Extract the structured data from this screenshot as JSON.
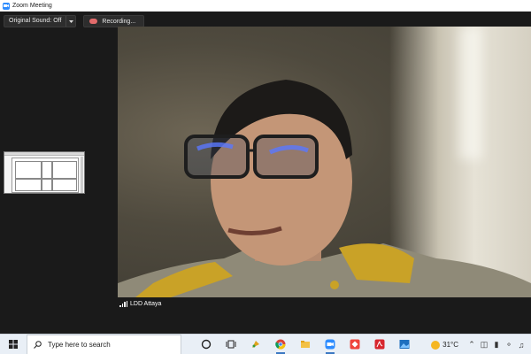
{
  "window": {
    "title": "Zoom Meeting"
  },
  "meeting_toolbar": {
    "original_sound_label": "Original Sound: Off",
    "recording_label": "Recording..."
  },
  "participant": {
    "name": "LDD Attaya"
  },
  "taskbar": {
    "search_placeholder": "Type here to search",
    "temperature": "31°C",
    "pinned_icons": [
      "cortana-icon",
      "task-view-icon",
      "paint-icon",
      "chrome-icon",
      "file-explorer-icon",
      "zoom-icon",
      "anydesk-icon",
      "acrobat-icon",
      "photos-icon"
    ],
    "tray_icons": [
      "chevron-up-icon",
      "network-icon",
      "battery-icon",
      "wifi-icon",
      "volume-icon"
    ]
  },
  "colors": {
    "zoom_blue": "#2d8cff",
    "meeting_bg": "#1a1a1a",
    "taskbar_bg": "#e9eff6",
    "recording_red": "#e26b6b"
  }
}
